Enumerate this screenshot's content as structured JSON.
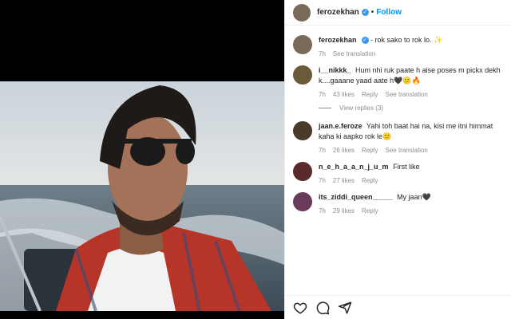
{
  "post": {
    "author": "ferozekhan",
    "follow_label": "Follow",
    "dot": "•",
    "caption": "- rok sako to rok lo. ✨",
    "caption_time": "7h",
    "see_translation": "See translation"
  },
  "comments": [
    {
      "user": "i__nikkk_",
      "text": "Hum nhi ruk paate h aise poses m pickx dekh k....gaaane yaad aate h🖤🙂🔥",
      "time": "7h",
      "likes": "43 likes",
      "reply": "Reply",
      "translation": "See translation",
      "view_replies": "View replies (3)"
    },
    {
      "user": "jaan.e.feroze",
      "text": "Yahi toh baat hai na, kisi me itni himmat kaha ki aapko rok le🙂",
      "time": "7h",
      "likes": "26 likes",
      "reply": "Reply",
      "translation": "See translation"
    },
    {
      "user": "n_e_h_a_a_n_j_u_m",
      "text": "First like",
      "time": "7h",
      "likes": "27 likes",
      "reply": "Reply"
    },
    {
      "user": "its_ziddi_queen_____",
      "text": "My jaan🖤",
      "time": "7h",
      "likes": "29 likes",
      "reply": "Reply"
    }
  ],
  "icons": [
    "heart-icon",
    "comment-icon",
    "share-icon"
  ]
}
